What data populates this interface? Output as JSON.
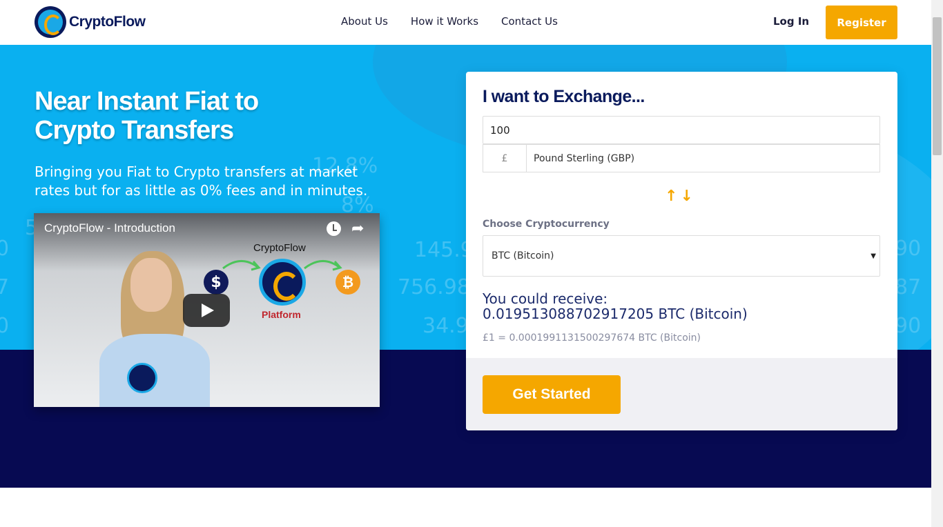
{
  "header": {
    "brand": "CryptoFlow",
    "nav": [
      {
        "label": "About Us"
      },
      {
        "label": "How it Works"
      },
      {
        "label": "Contact Us"
      }
    ],
    "login_label": "Log In",
    "register_label": "Register"
  },
  "hero": {
    "title": "Near Instant Fiat to Crypto Transfers",
    "subtitle": "Bringing you Fiat to Crypto transfers at market rates but for as little as 0% fees and in minutes.",
    "bg_numbers": [
      "12.8%",
      "8%",
      "145.9",
      "756.98",
      "34.9",
      "90",
      "87",
      "90",
      "5",
      "0",
      "7",
      "0"
    ]
  },
  "video": {
    "title": "CryptoFlow - Introduction",
    "flow_label": "CryptoFlow",
    "platform_label": "Platform",
    "dollar_symbol": "$",
    "btc_symbol": "₿"
  },
  "exchange": {
    "title": "I want to Exchange...",
    "amount": "100",
    "currency_symbol": "£",
    "currency_name": "Pound Sterling (GBP)",
    "crypto_label": "Choose Cryptocurrency",
    "crypto_selected": "BTC (Bitcoin)",
    "receive_label": "You could receive:",
    "receive_value": "0.019513088702917205 BTC (Bitcoin)",
    "rate": "£1 = 0.0001991131500297674 BTC (Bitcoin)",
    "cta_label": "Get Started"
  },
  "colors": {
    "primary_blue": "#0ab0f0",
    "navy": "#070a52",
    "accent": "#f5a700"
  }
}
